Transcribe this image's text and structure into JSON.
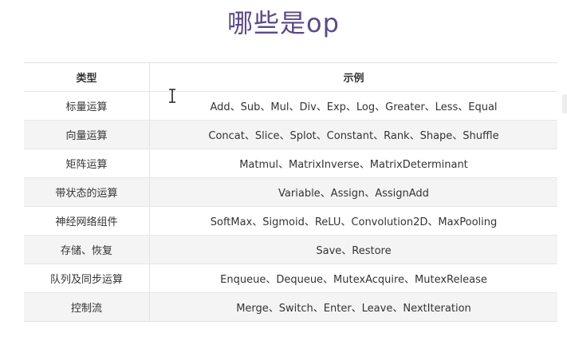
{
  "title": "哪些是op",
  "table": {
    "headers": [
      "类型",
      "示例"
    ],
    "rows": [
      {
        "type": "标量运算",
        "examples": "Add、Sub、Mul、Div、Exp、Log、Greater、Less、Equal"
      },
      {
        "type": "向量运算",
        "examples": "Concat、Slice、Splot、Constant、Rank、Shape、Shuffle"
      },
      {
        "type": "矩阵运算",
        "examples": "Matmul、MatrixInverse、MatrixDeterminant"
      },
      {
        "type": "带状态的运算",
        "examples": "Variable、Assign、AssignAdd"
      },
      {
        "type": "神经网络组件",
        "examples": "SoftMax、Sigmoid、ReLU、Convolution2D、MaxPooling"
      },
      {
        "type": "存储、恢复",
        "examples": "Save、Restore"
      },
      {
        "type": "队列及同步运算",
        "examples": "Enqueue、Dequeue、MutexAcquire、MutexRelease"
      },
      {
        "type": "控制流",
        "examples": "Merge、Switch、Enter、Leave、NextIteration"
      }
    ]
  },
  "cursor_icon": "text-cursor-icon"
}
